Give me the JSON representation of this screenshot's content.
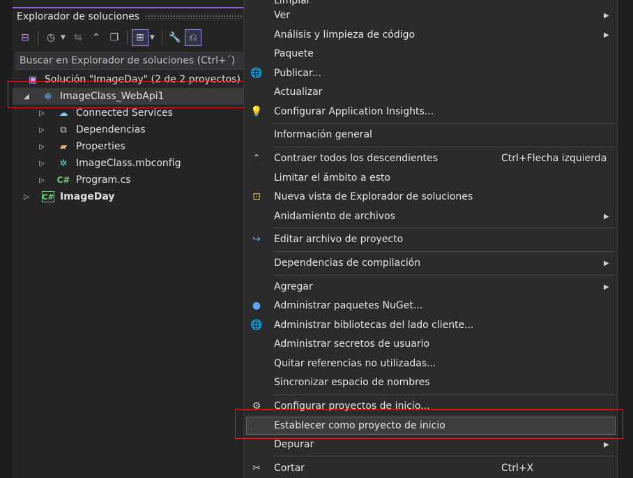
{
  "explorer": {
    "title": "Explorador de soluciones",
    "search_placeholder": "Buscar en Explorador de soluciones (Ctrl+´)",
    "tree": {
      "solution": "Solución \"ImageDay\"  (2 de 2 proyectos)",
      "project": "ImageClass_WebApi1",
      "children": [
        "Connected Services",
        "Dependencias",
        "Properties",
        "ImageClass.mbconfig",
        "Program.cs"
      ],
      "project2": "ImageDay"
    }
  },
  "menu": {
    "top_partial": "Limpiar",
    "ver": "Ver",
    "analisis": "Análisis y limpieza de código",
    "paquete": "Paquete",
    "publicar": "Publicar...",
    "actualizar": "Actualizar",
    "app_insights": "Configurar Application Insights...",
    "info_general": "Información general",
    "contraer": "Contraer todos los descendientes",
    "contraer_shortcut": "Ctrl+Flecha izquierda",
    "limitar": "Limitar el ámbito a esto",
    "nueva_vista": "Nueva vista de Explorador de soluciones",
    "anidamiento": "Anidamiento de archivos",
    "editar_archivo": "Editar archivo de proyecto",
    "dependencias_comp": "Dependencias de compilación",
    "agregar": "Agregar",
    "nuget": "Administrar paquetes NuGet...",
    "bibliotecas": "Administrar bibliotecas del lado cliente...",
    "secretos": "Administrar secretos de usuario",
    "quitar_refs": "Quitar referencias no utilizadas...",
    "sincronizar": "Sincronizar espacio de nombres",
    "config_inicio": "Configurar proyectos de inicio...",
    "establecer": "Establecer como proyecto de inicio",
    "depurar": "Depurar",
    "cortar": "Cortar",
    "cortar_shortcut": "Ctrl+X"
  }
}
